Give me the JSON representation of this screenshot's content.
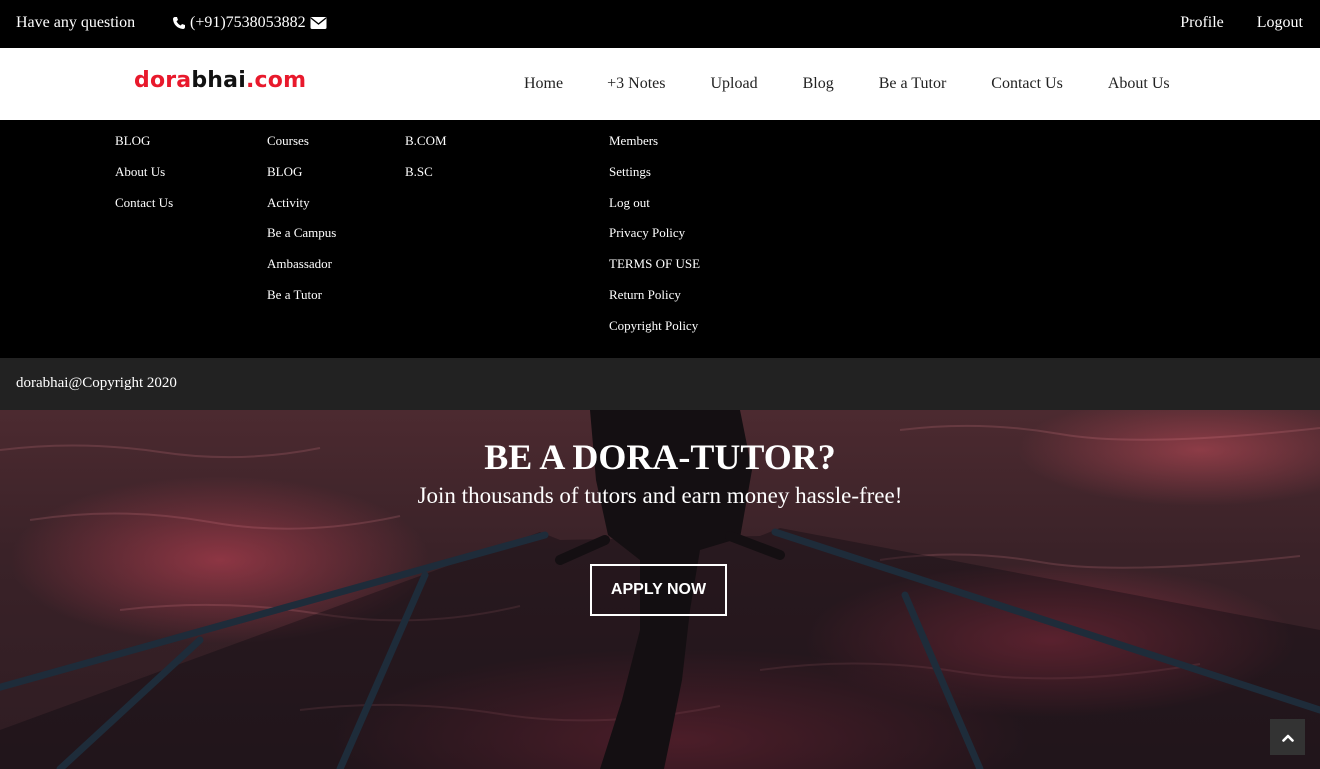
{
  "topbar": {
    "question": "Have any question",
    "phone": "(+91)7538053882",
    "profile": "Profile",
    "logout": "Logout"
  },
  "navbar": {
    "logo_part1": "dora",
    "logo_part2": "bhai",
    "logo_part3": ".com",
    "items": [
      "Home",
      "+3 Notes",
      "Upload",
      "Blog",
      "Be a Tutor",
      "Contact Us",
      "About Us"
    ]
  },
  "footer": {
    "col1": [
      "BLOG",
      "About Us",
      "Contact Us"
    ],
    "col2": [
      "Courses",
      "BLOG",
      "Activity",
      "Be a Campus",
      "Ambassador",
      "Be a Tutor"
    ],
    "col3": [
      "B.COM",
      "B.SC"
    ],
    "col4": [
      "Members",
      "Settings",
      "Log out",
      "Privacy Policy",
      "TERMS OF USE",
      "Return Policy",
      "Copyright Policy"
    ]
  },
  "copyright": "dorabhai@Copyright 2020",
  "hero": {
    "title": "BE A DORA-TUTOR?",
    "subtitle": "Join thousands of tutors and earn money hassle-free!",
    "cta": "APPLY NOW"
  },
  "colors": {
    "brand_red": "#e8192c",
    "brand_dark": "#111111",
    "copyright_bg": "#222222"
  }
}
